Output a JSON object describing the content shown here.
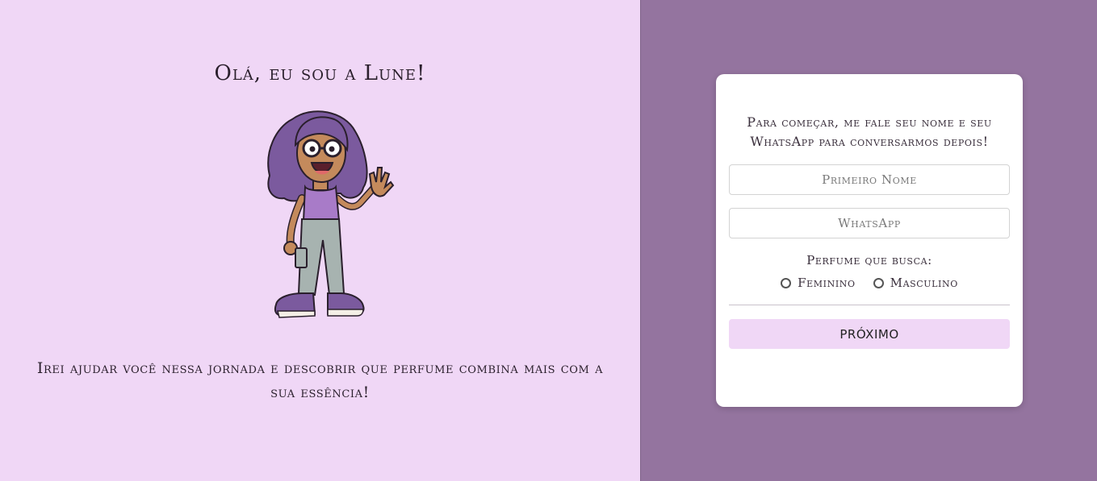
{
  "left": {
    "greeting": "Olá, eu sou a Lune!",
    "mascot_icon": "waving-girl-illustration",
    "intro": "Irei ajudar você nessa jornada e descobrir que perfume combina mais com a sua essência!"
  },
  "form": {
    "prompt": "Para começar, me fale seu nome e seu WhatsApp para conversarmos depois!",
    "first_name": {
      "placeholder": "Primeiro Nome",
      "value": ""
    },
    "whatsapp": {
      "placeholder": "WhatsApp",
      "value": ""
    },
    "question": "Perfume que busca:",
    "options": [
      {
        "label": "Feminino",
        "selected": false
      },
      {
        "label": "Masculino",
        "selected": false
      }
    ],
    "next_label": "PRÓXIMO"
  },
  "colors": {
    "left_background": "#f0d7f6",
    "right_background": "#94749f",
    "card_background": "#ffffff",
    "button_background": "#f0d7f6"
  }
}
